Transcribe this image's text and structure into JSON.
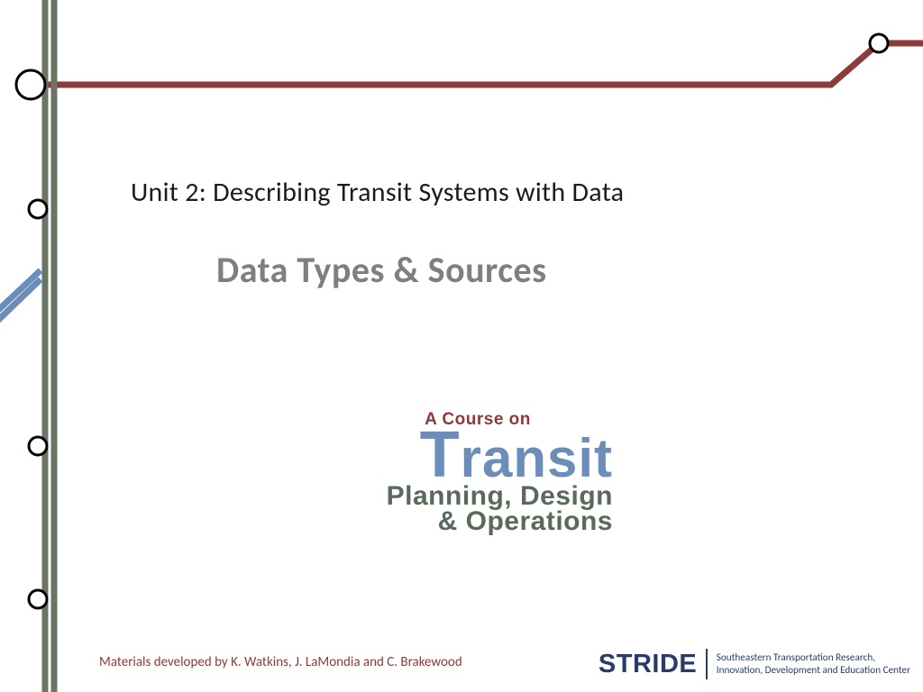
{
  "unit_line": "Unit 2: Describing Transit Systems with Data",
  "subtitle": "Data Types & Sources",
  "course_logo": {
    "line1": "A Course on",
    "line2": "Transit",
    "line3a": "Planning, Design",
    "line3b": "& Operations"
  },
  "credits": "Materials developed by K. Watkins, J. LaMondia and C. Brakewood",
  "stride": {
    "word": "STRIDE",
    "tag1": "Southeastern Transportation Research,",
    "tag2": "Innovation, Development and Education Center"
  }
}
